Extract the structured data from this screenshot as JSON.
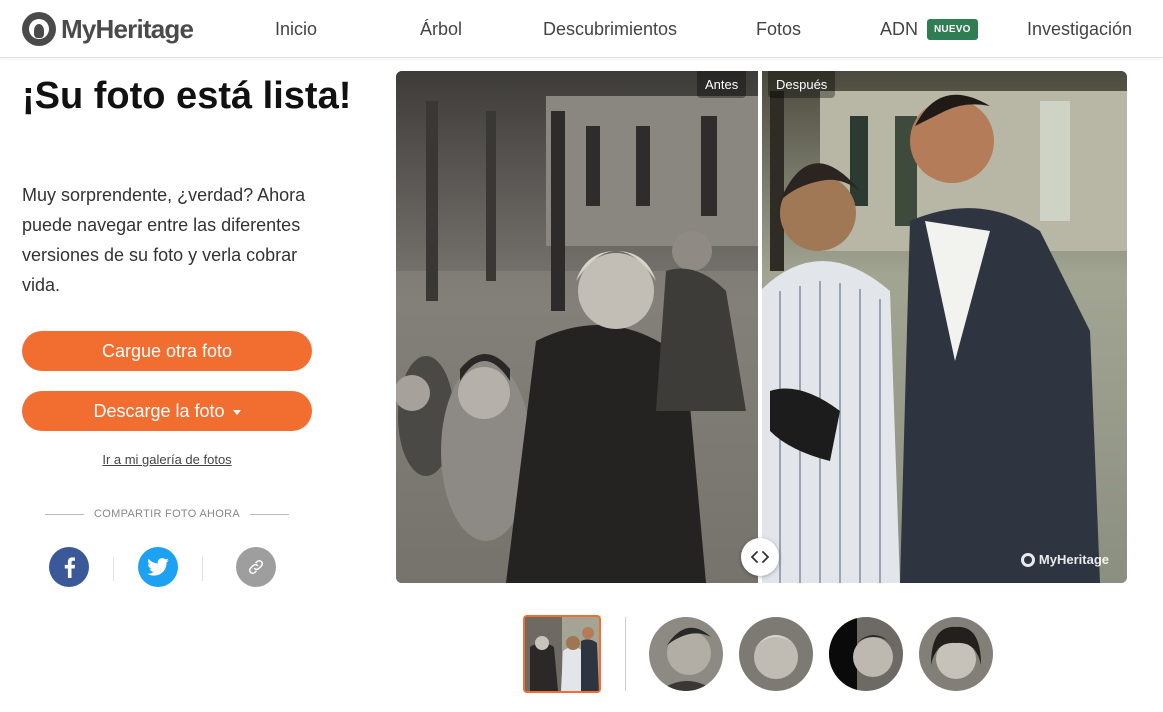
{
  "brand": {
    "name": "MyHeritage"
  },
  "nav": {
    "items": [
      "Inicio",
      "Árbol",
      "Descubrimientos",
      "Fotos",
      "ADN",
      "Investigación"
    ],
    "badge": "NUEVO"
  },
  "main": {
    "title": "¡Su foto está lista!",
    "description": "Muy sorprendente, ¿verdad? Ahora puede navegar entre las diferentes versiones de su foto y verla cobrar vida.",
    "upload_button": "Cargue otra foto",
    "download_button": "Descarge la foto",
    "gallery_link": "Ir a mi galería de fotos",
    "share_label": "COMPARTIR FOTO AHORA"
  },
  "photo": {
    "before_label": "Antes",
    "after_label": "Después",
    "watermark": "MyHeritage"
  },
  "colors": {
    "accent": "#f26d30",
    "facebook": "#3b5998",
    "twitter": "#1da1f2",
    "link": "#9e9e9e",
    "badge": "#2f7d53"
  },
  "icons": [
    "facebook-icon",
    "twitter-icon",
    "link-icon",
    "compare-arrows-icon",
    "caret-down-icon"
  ]
}
